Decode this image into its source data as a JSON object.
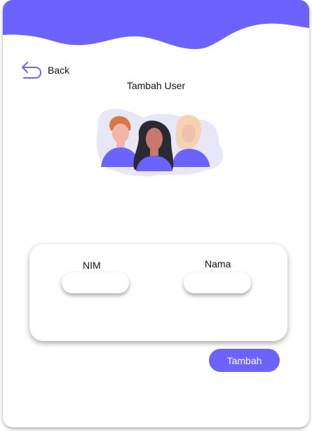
{
  "header": {
    "back_label": "Back",
    "title": "Tambah User"
  },
  "form": {
    "nim_label": "NIM",
    "nim_value": "",
    "nama_label": "Nama",
    "nama_value": "",
    "submit_label": "Tambah"
  },
  "colors": {
    "accent": "#6c63ff",
    "wave": "#6c63ff"
  },
  "icons": {
    "back": "undo-arrow-icon"
  }
}
